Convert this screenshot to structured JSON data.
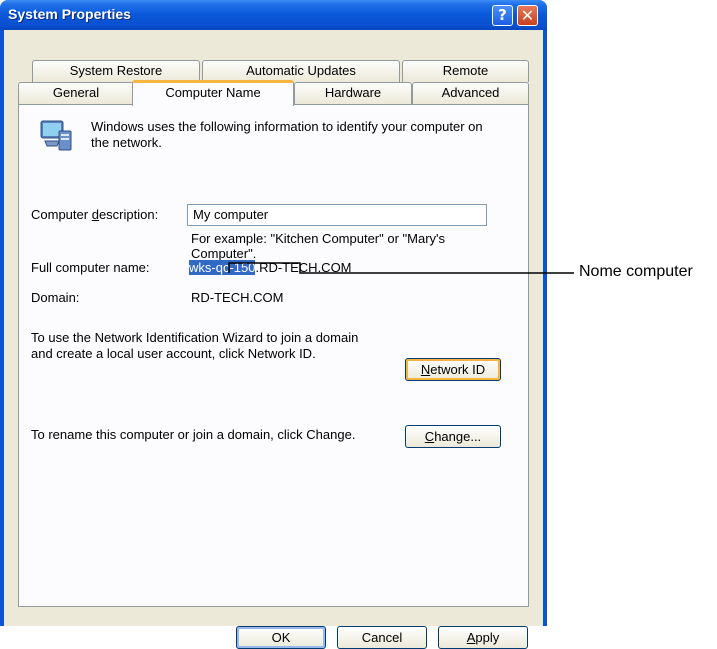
{
  "window": {
    "title": "System Properties",
    "help_glyph": "?",
    "close_glyph": "✕"
  },
  "tabs": {
    "row1": [
      "System Restore",
      "Automatic Updates",
      "Remote"
    ],
    "row2": [
      "General",
      "Computer Name",
      "Hardware",
      "Advanced"
    ],
    "active": "Computer Name"
  },
  "panel": {
    "intro": "Windows uses the following information to identify your computer on the network.",
    "desc_label_pre": "Computer ",
    "desc_label_u": "d",
    "desc_label_post": "escription:",
    "desc_value": "My computer",
    "example": "For example: \"Kitchen Computer\" or \"Mary's Computer\".",
    "full_name_label": "Full computer name:",
    "full_name_host": "wks-qc-150",
    "full_name_domain": ".RD-TECH.COM",
    "domain_label": "Domain:",
    "domain_value": "RD-TECH.COM",
    "wizard_text": "To use the Network Identification Wizard to join a domain and create a local user account, click Network ID.",
    "network_id_u": "N",
    "network_id_rest": "etwork ID",
    "rename_text": "To rename this computer or join a domain, click Change.",
    "change_u": "C",
    "change_rest": "hange..."
  },
  "footer": {
    "ok": "OK",
    "cancel": "Cancel",
    "apply_u": "A",
    "apply_rest": "pply"
  },
  "callout": {
    "label": "Nome computer"
  },
  "colors": {
    "titlebar": "#0a58da",
    "selection": "#316ac5",
    "active_tab_accent": "#f7b43f"
  }
}
